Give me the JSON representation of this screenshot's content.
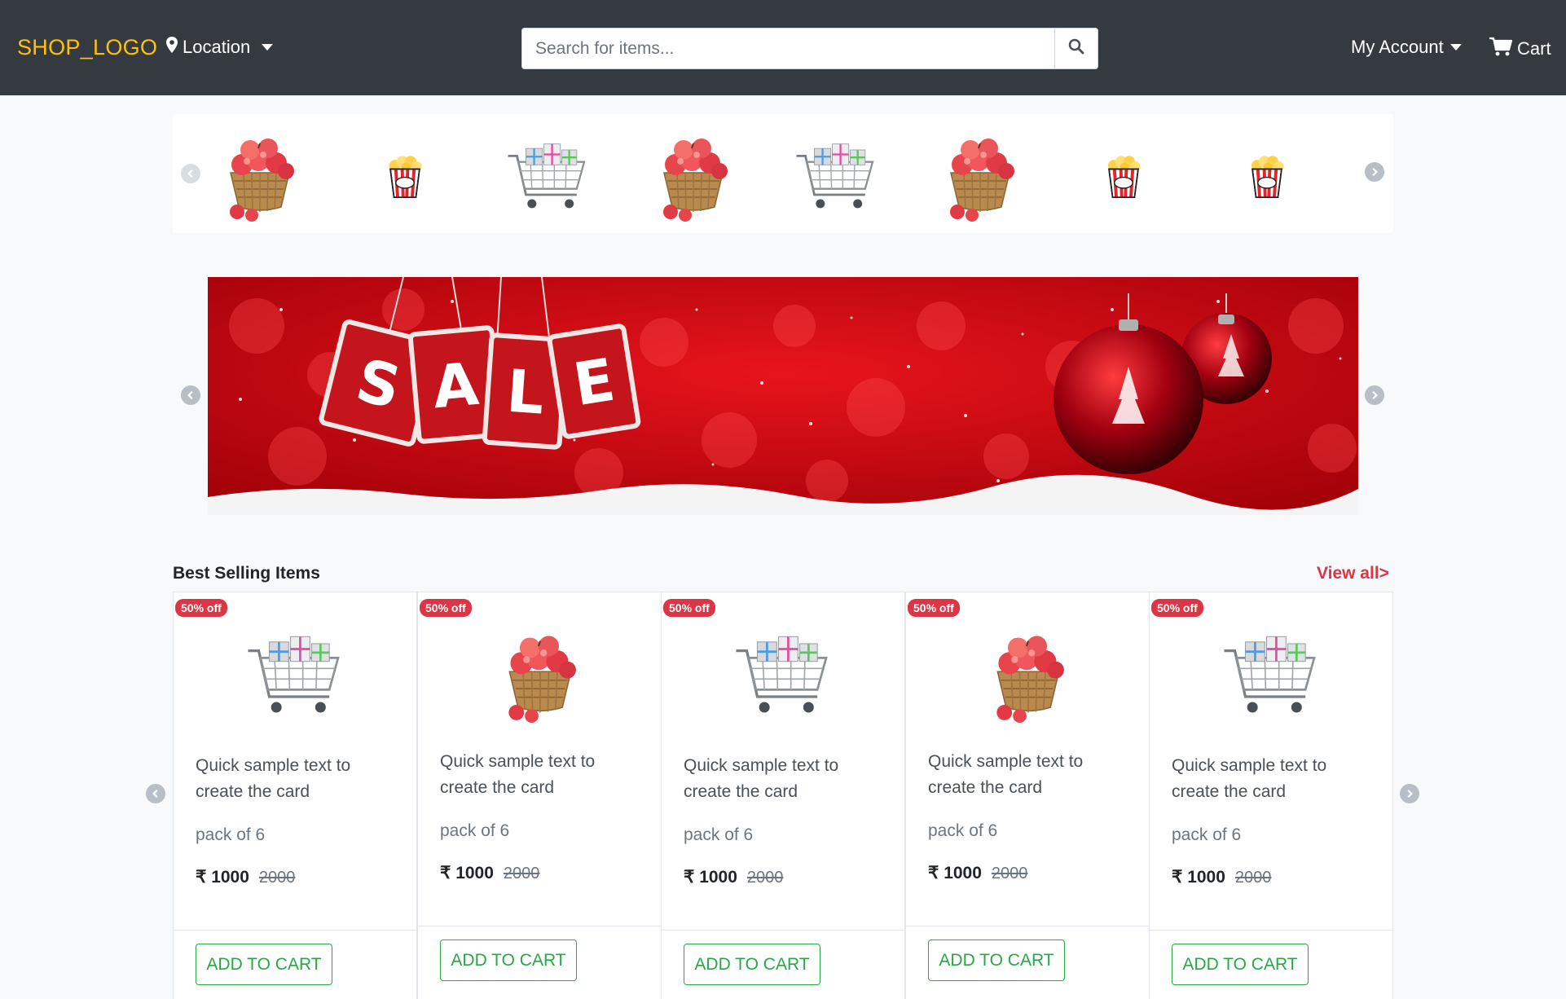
{
  "navbar": {
    "logo": "SHOP_LOGO",
    "location_label": "Location",
    "search_placeholder": "Search for items...",
    "account_label": "My Account",
    "cart_label": "Cart"
  },
  "category_strip": {
    "items": [
      {
        "icon": "apple-basket-icon"
      },
      {
        "icon": "popcorn-icon"
      },
      {
        "icon": "gift-cart-icon"
      },
      {
        "icon": "apple-basket-icon"
      },
      {
        "icon": "gift-cart-icon"
      },
      {
        "icon": "apple-basket-icon"
      },
      {
        "icon": "popcorn-icon"
      },
      {
        "icon": "popcorn-icon"
      }
    ]
  },
  "banner": {
    "letters": [
      "S",
      "A",
      "L",
      "E"
    ]
  },
  "best_selling": {
    "title": "Best Selling Items",
    "view_all": "View all>",
    "cards": [
      {
        "badge": "50% off",
        "icon": "gift-cart-icon",
        "text": "Quick sample text to create the card",
        "pack": "pack of 6",
        "price": "₹ 1000",
        "old_price": "2000",
        "button": "ADD TO CART"
      },
      {
        "badge": "50% off",
        "icon": "apple-basket-icon",
        "text": "Quick sample text to create the card",
        "pack": "pack of 6",
        "price": "₹ 1000",
        "old_price": "2000",
        "button": "ADD TO CART"
      },
      {
        "badge": "50% off",
        "icon": "gift-cart-icon",
        "text": "Quick sample text to create the card",
        "pack": "pack of 6",
        "price": "₹ 1000",
        "old_price": "2000",
        "button": "ADD TO CART"
      },
      {
        "badge": "50% off",
        "icon": "apple-basket-icon",
        "text": "Quick sample text to create the card",
        "pack": "pack of 6",
        "price": "₹ 1000",
        "old_price": "2000",
        "button": "ADD TO CART"
      },
      {
        "badge": "50% off",
        "icon": "gift-cart-icon",
        "text": "Quick sample text to create the card",
        "pack": "pack of 6",
        "price": "₹ 1000",
        "old_price": "2000",
        "button": "ADD TO CART"
      }
    ]
  },
  "colors": {
    "navbar_bg": "#343a40",
    "logo": "#ffc107",
    "accent_red": "#dc3545",
    "button_green": "#28a745"
  }
}
